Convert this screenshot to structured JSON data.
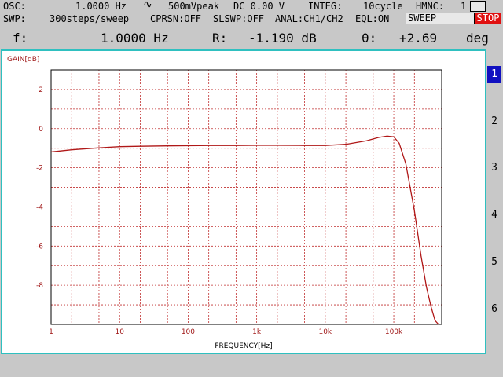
{
  "status": {
    "osc_label": "OSC:",
    "osc_freq": "1.0000 Hz",
    "osc_wave": "∿",
    "osc_amp": "500mVpeak",
    "osc_dc": "DC  0.00 V",
    "integ_label": "INTEG:",
    "integ_value": "10cycle",
    "hmnc_label": "HMNC:",
    "hmnc_value": "1",
    "swp_label": "SWP:",
    "swp_steps": "300steps/sweep",
    "cprsn": "CPRSN:OFF",
    "slswp": "SLSWP:OFF",
    "anal": "ANAL:CH1/CH2",
    "eql": "EQL:ON",
    "sweep_button": "SWEEP",
    "stop_button": "STOP"
  },
  "readout": {
    "f_label": "f:",
    "f_value": "1.0000 Hz",
    "r_label": "R:",
    "r_value": "-1.190 dB",
    "theta_label": "θ:",
    "theta_value": "+2.69",
    "theta_unit": "deg"
  },
  "softkeys": [
    "1",
    "2",
    "3",
    "4",
    "5",
    "6"
  ],
  "colors": {
    "background": "#c8c8c8",
    "panel_border": "#2fc0c0",
    "trace": "#b01818",
    "grid": "#c03030",
    "axis_label": "#a01818",
    "stop": "#e01010",
    "softkey_active": "#1010c0"
  },
  "chart_data": {
    "type": "line",
    "title": "",
    "xlabel": "FREQUENCY[Hz]",
    "ylabel": "GAIN[dB]",
    "x_scale": "log",
    "xlim": [
      1,
      500000
    ],
    "ylim": [
      -10,
      3
    ],
    "x_ticks": [
      1,
      10,
      100,
      1000,
      10000,
      100000
    ],
    "x_tick_labels": [
      "1",
      "10",
      "100",
      "1k",
      "10k",
      "100k"
    ],
    "y_ticks": [
      2,
      0,
      -2,
      -4,
      -6,
      -8
    ],
    "y_tick_labels": [
      "2",
      "0",
      "-2",
      "-4",
      "-6",
      "-8"
    ],
    "grid": true,
    "series": [
      {
        "x": [
          1,
          2,
          5,
          10,
          20,
          50,
          100,
          200,
          500,
          1000,
          2000,
          5000,
          10000,
          20000,
          40000,
          60000,
          80000,
          100000,
          120000,
          150000,
          200000,
          250000,
          300000,
          350000,
          400000,
          450000
        ],
        "y": [
          -1.19,
          -1.08,
          -0.98,
          -0.92,
          -0.9,
          -0.88,
          -0.87,
          -0.86,
          -0.86,
          -0.85,
          -0.85,
          -0.86,
          -0.86,
          -0.8,
          -0.62,
          -0.45,
          -0.38,
          -0.42,
          -0.75,
          -1.8,
          -4.2,
          -6.5,
          -8.1,
          -9.1,
          -9.8,
          -10.0
        ]
      }
    ]
  }
}
